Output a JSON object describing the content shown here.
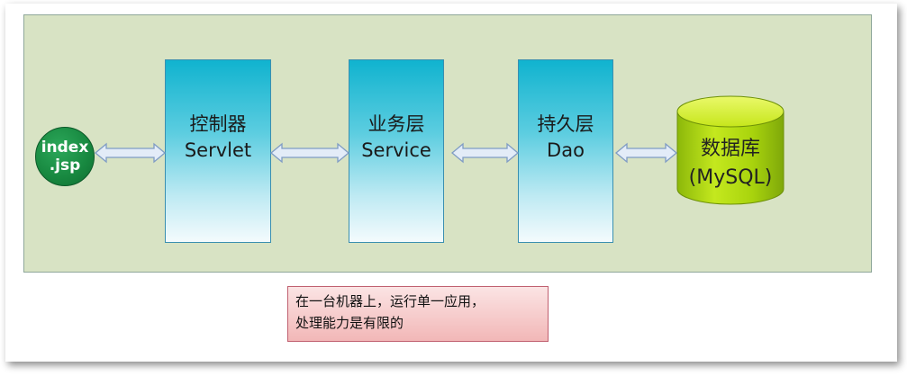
{
  "diagram": {
    "client": {
      "line1": "index",
      "line2": ".jsp"
    },
    "layers": [
      {
        "title": "控制器",
        "subtitle": "Servlet"
      },
      {
        "title": "业务层",
        "subtitle": "Service"
      },
      {
        "title": "持久层",
        "subtitle": "Dao"
      }
    ],
    "database": {
      "title": "数据库",
      "subtitle": "(MySQL)"
    },
    "note": {
      "line1": "在一台机器上，运行单一应用，",
      "line2": "处理能力是有限的"
    }
  },
  "colors": {
    "panel": "#d8e3c4",
    "layer_box": "#10b3cf",
    "client_circle": "#17873f",
    "database_cylinder": "#a9d40d",
    "arrow_fill": "#e3ecf8",
    "arrow_stroke": "#7f9cc4",
    "note_fill": "#f2b7b7"
  }
}
